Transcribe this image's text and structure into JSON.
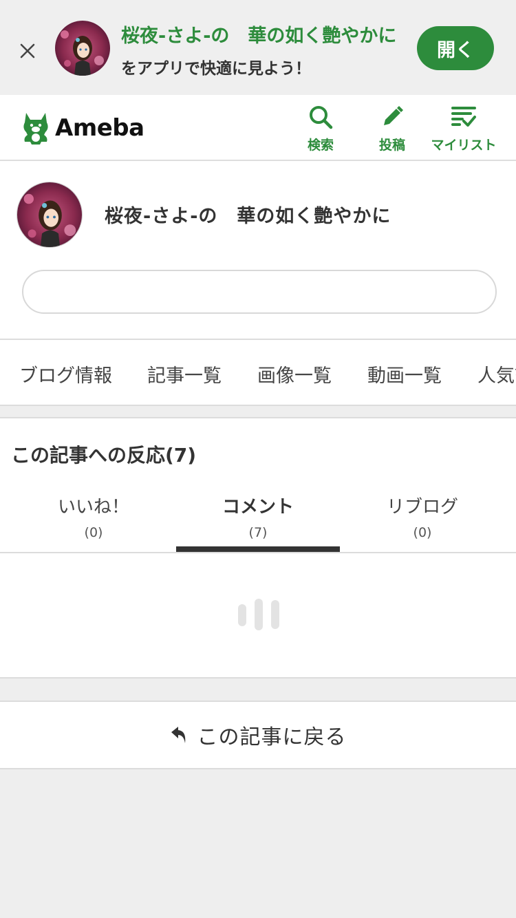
{
  "banner": {
    "close_icon": "close-icon",
    "title": "桜夜-さよ-の　華の如く艶やかに",
    "subtitle": "をアプリで快適に見よう！",
    "open_label": "開く"
  },
  "header": {
    "logo_text": "Ameba",
    "actions": [
      {
        "label": "検索",
        "icon": "search-icon"
      },
      {
        "label": "投稿",
        "icon": "pencil-icon"
      },
      {
        "label": "マイリスト",
        "icon": "mylist-icon"
      }
    ]
  },
  "blog": {
    "title": "桜夜-さよ-の　華の如く艶やかに",
    "search_value": ""
  },
  "nav": {
    "tabs": [
      "ブログ情報",
      "記事一覧",
      "画像一覧",
      "動画一覧",
      "人気記事"
    ]
  },
  "reactions": {
    "title": "この記事への反応(7)",
    "tabs": [
      {
        "label": "いいね！",
        "count": "(0)"
      },
      {
        "label": "コメント",
        "count": "(7)"
      },
      {
        "label": "リブログ",
        "count": "(0)"
      }
    ],
    "active_tab": 1
  },
  "back": {
    "label": "この記事に戻る",
    "icon": "reply-arrow-icon"
  },
  "colors": {
    "brand_green": "#2d8c3c",
    "background": "#eeeeee"
  }
}
